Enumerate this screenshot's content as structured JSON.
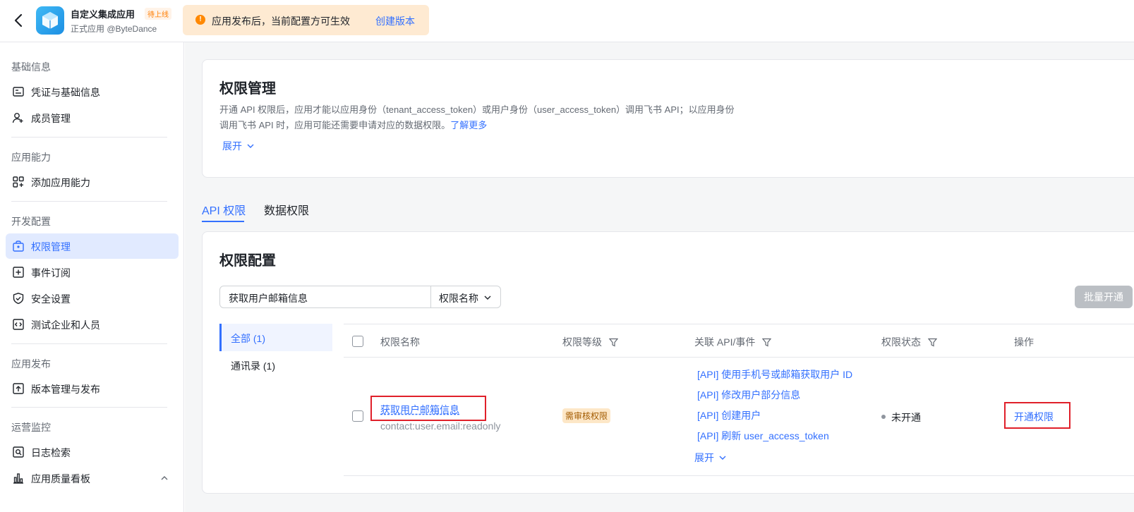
{
  "header": {
    "app_title": "自定义集成应用",
    "app_badge": "待上线",
    "app_subtitle": "正式应用 @ByteDance",
    "notice_text": "应用发布后，当前配置方可生效",
    "notice_link": "创建版本"
  },
  "sidebar": {
    "sections": [
      {
        "title": "基础信息",
        "items": [
          {
            "label": "凭证与基础信息",
            "icon": "id-card-icon"
          },
          {
            "label": "成员管理",
            "icon": "add-member-icon"
          }
        ]
      },
      {
        "title": "应用能力",
        "items": [
          {
            "label": "添加应用能力",
            "icon": "apps-add-icon"
          }
        ]
      },
      {
        "title": "开发配置",
        "items": [
          {
            "label": "权限管理",
            "icon": "lock-box-icon",
            "active": true
          },
          {
            "label": "事件订阅",
            "icon": "event-plus-icon"
          },
          {
            "label": "安全设置",
            "icon": "shield-icon"
          },
          {
            "label": "测试企业和人员",
            "icon": "code-box-icon"
          }
        ]
      },
      {
        "title": "应用发布",
        "items": [
          {
            "label": "版本管理与发布",
            "icon": "upload-box-icon"
          }
        ]
      },
      {
        "title": "运营监控",
        "items": [
          {
            "label": "日志检索",
            "icon": "log-search-icon"
          },
          {
            "label": "应用质量看板",
            "icon": "bar-chart-icon"
          }
        ]
      }
    ]
  },
  "permission_intro": {
    "title": "权限管理",
    "desc_line1": "开通 API 权限后，应用才能以应用身份（tenant_access_token）或用户身份（user_access_token）调用飞书 API；以应用身份",
    "desc_line2": "调用飞书 API 时，应用可能还需要申请对应的数据权限。",
    "learn_more": "了解更多",
    "expand": "展开"
  },
  "tabs": [
    "API 权限",
    "数据权限"
  ],
  "config": {
    "title": "权限配置",
    "search_value": "获取用户邮箱信息",
    "select_value": "权限名称",
    "batch_button": "批量开通",
    "categories": [
      "全部 (1)",
      "通讯录 (1)"
    ],
    "columns": [
      "权限名称",
      "权限等级",
      "关联 API/事件",
      "权限状态",
      "操作"
    ],
    "rows": [
      {
        "name": "获取用户邮箱信息",
        "code": "contact:user.email:readonly",
        "level": "需审核权限",
        "apis": [
          "[API] 使用手机号或邮箱获取用户 ID",
          "[API] 修改用户部分信息",
          "[API] 创建用户",
          "[API] 刷新 user_access_token"
        ],
        "apis_expand": "展开",
        "status": "未开通",
        "action": "开通权限"
      }
    ]
  },
  "colors": {
    "accent": "#3370ff",
    "highlight": "#e0202a",
    "notice_bg": "#feead2"
  }
}
